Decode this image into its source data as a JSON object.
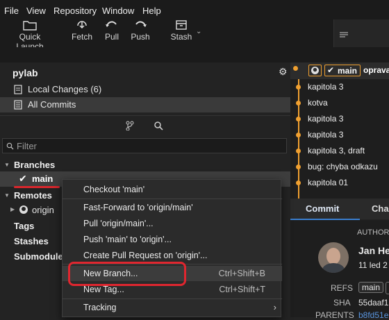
{
  "menubar": {
    "items": [
      "File",
      "View",
      "Repository",
      "Window",
      "Help"
    ]
  },
  "toolbar": {
    "quick_launch": "Quick Launch",
    "fetch": "Fetch",
    "pull": "Pull",
    "push": "Push",
    "stash": "Stash"
  },
  "sidebar": {
    "repo_name": "pylab",
    "local_changes": "Local Changes (6)",
    "all_commits": "All Commits",
    "filter_placeholder": "Filter",
    "branches": "Branches",
    "current_branch": "main",
    "remotes": "Remotes",
    "origin": "origin",
    "tags": "Tags",
    "stashes": "Stashes",
    "submodules": "Submodule"
  },
  "graph": {
    "head_branch": "main",
    "head_message": "oprava",
    "commits": [
      "kapitola 3",
      "kotva",
      "kapitola 3",
      "kapitola 3",
      "kapitola 3, draft",
      "bug: chyba odkazu",
      "kapitola 01"
    ]
  },
  "details": {
    "tab_commit": "Commit",
    "tab_changes": "Cha",
    "author_label": "AUTHOR",
    "author_name": "Jan He",
    "author_date": "11 led 2",
    "refs_label": "REFS",
    "refs_value": "main",
    "sha_label": "SHA",
    "sha_value": "55daaf1",
    "parents_label": "PARENTS",
    "parents_value": "b8fd51e"
  },
  "context_menu": {
    "checkout": "Checkout 'main'",
    "fast_forward": "Fast-Forward to 'origin/main'",
    "pull": "Pull 'origin/main'...",
    "push": "Push 'main' to 'origin'...",
    "create_pr": "Create Pull Request on 'origin'...",
    "new_branch": "New Branch...",
    "new_branch_shortcut": "Ctrl+Shift+B",
    "new_tag": "New Tag...",
    "new_tag_shortcut": "Ctrl+Shift+T",
    "tracking": "Tracking"
  },
  "colors": {
    "accent_orange": "#f0a030",
    "highlight_red": "#e0262f",
    "tab_blue": "#3a7fd0"
  }
}
